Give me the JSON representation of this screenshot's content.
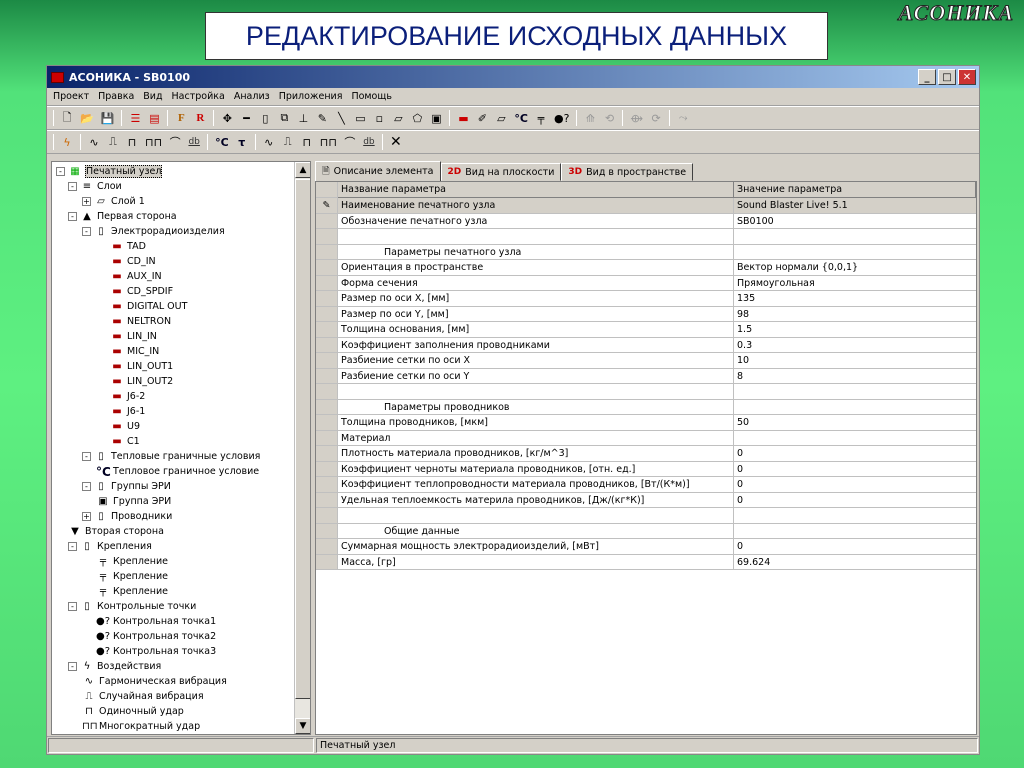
{
  "slide_title": "РЕДАКТИРОВАНИЕ ИСХОДНЫХ ДАННЫХ",
  "logo": "АСОНИКА",
  "window": {
    "title": "АСОНИКА - SB0100"
  },
  "menu": [
    "Проект",
    "Правка",
    "Вид",
    "Настройка",
    "Анализ",
    "Приложения",
    "Помощь"
  ],
  "toolbar1": {
    "f_label": "F",
    "r_label": "R",
    "celsius": "°C"
  },
  "toolbar2": {
    "db": "db",
    "celsius": "°C",
    "tau": "τ"
  },
  "tree": [
    {
      "label": "Печатный узел",
      "level": 0,
      "exp": "-",
      "icon": "board-icon",
      "glyph": "▦",
      "sel": true
    },
    {
      "label": "Слои",
      "level": 1,
      "exp": "-",
      "icon": "layers-icon",
      "glyph": "≡"
    },
    {
      "label": "Слой 1",
      "level": 2,
      "exp": "+",
      "icon": "layer-icon",
      "glyph": "▱"
    },
    {
      "label": "Первая сторона",
      "level": 1,
      "exp": "-",
      "icon": "side-icon",
      "glyph": "▲"
    },
    {
      "label": "Электрорадиоизделия",
      "level": 2,
      "exp": "-",
      "icon": "folder-icon",
      "glyph": "▯"
    },
    {
      "label": "TAD",
      "level": 4,
      "icon": "component-icon",
      "glyph": "▬"
    },
    {
      "label": "CD_IN",
      "level": 4,
      "icon": "component-icon",
      "glyph": "▬"
    },
    {
      "label": "AUX_IN",
      "level": 4,
      "icon": "component-icon",
      "glyph": "▬"
    },
    {
      "label": "CD_SPDIF",
      "level": 4,
      "icon": "component-icon",
      "glyph": "▬"
    },
    {
      "label": "DIGITAL OUT",
      "level": 4,
      "icon": "component-icon",
      "glyph": "▬"
    },
    {
      "label": "NELTRON",
      "level": 4,
      "icon": "component-icon",
      "glyph": "▬"
    },
    {
      "label": "LIN_IN",
      "level": 4,
      "icon": "component-icon",
      "glyph": "▬"
    },
    {
      "label": "MIC_IN",
      "level": 4,
      "icon": "component-icon",
      "glyph": "▬"
    },
    {
      "label": "LIN_OUT1",
      "level": 4,
      "icon": "component-icon",
      "glyph": "▬"
    },
    {
      "label": "LIN_OUT2",
      "level": 4,
      "icon": "component-icon",
      "glyph": "▬"
    },
    {
      "label": "J6-2",
      "level": 4,
      "icon": "component-icon",
      "glyph": "▬"
    },
    {
      "label": "J6-1",
      "level": 4,
      "icon": "component-icon",
      "glyph": "▬"
    },
    {
      "label": "U9",
      "level": 4,
      "icon": "component-icon",
      "glyph": "▬"
    },
    {
      "label": "C1",
      "level": 4,
      "icon": "component-icon",
      "glyph": "▬"
    },
    {
      "label": "Тепловые граничные условия",
      "level": 2,
      "exp": "-",
      "icon": "folder-icon",
      "glyph": "▯"
    },
    {
      "label": "Тепловое граничное условие",
      "level": 3,
      "icon": "celsius-icon",
      "glyph": "°C"
    },
    {
      "label": "Группы ЭРИ",
      "level": 2,
      "exp": "-",
      "icon": "folder-icon",
      "glyph": "▯"
    },
    {
      "label": "Группа ЭРИ",
      "level": 3,
      "icon": "group-icon",
      "glyph": "▣"
    },
    {
      "label": "Проводники",
      "level": 2,
      "exp": "+",
      "icon": "folder-icon",
      "glyph": "▯"
    },
    {
      "label": "Вторая сторона",
      "level": 1,
      "icon": "side2-icon",
      "glyph": "▼"
    },
    {
      "label": "Крепления",
      "level": 1,
      "exp": "-",
      "icon": "folder-icon",
      "glyph": "▯"
    },
    {
      "label": "Крепление",
      "level": 3,
      "icon": "fastener-icon",
      "glyph": "╤"
    },
    {
      "label": "Крепление",
      "level": 3,
      "icon": "fastener-icon",
      "glyph": "╤"
    },
    {
      "label": "Крепление",
      "level": 3,
      "icon": "fastener-icon",
      "glyph": "╤"
    },
    {
      "label": "Контрольные точки",
      "level": 1,
      "exp": "-",
      "icon": "folder-icon",
      "glyph": "▯"
    },
    {
      "label": "Контрольная точка1",
      "level": 3,
      "icon": "checkpoint-icon",
      "glyph": "●?"
    },
    {
      "label": "Контрольная точка2",
      "level": 3,
      "icon": "checkpoint-icon",
      "glyph": "●?"
    },
    {
      "label": "Контрольная точка3",
      "level": 3,
      "icon": "checkpoint-icon",
      "glyph": "●?"
    },
    {
      "label": "Воздействия",
      "level": 1,
      "exp": "-",
      "icon": "lightning-icon",
      "glyph": "ϟ"
    },
    {
      "label": "Гармоническая вибрация",
      "level": 2,
      "icon": "sine-icon",
      "glyph": "∿"
    },
    {
      "label": "Случайная вибрация",
      "level": 2,
      "icon": "random-icon",
      "glyph": "⎍"
    },
    {
      "label": "Одиночный удар",
      "level": 2,
      "icon": "pulse-icon",
      "glyph": "⊓"
    },
    {
      "label": "Многократный удар",
      "level": 2,
      "icon": "pulses-icon",
      "glyph": "⊓⊓"
    }
  ],
  "tabs": [
    {
      "label": "Описание элемента",
      "prefix": "",
      "active": true
    },
    {
      "label": "Вид на плоскости",
      "prefix": "2D"
    },
    {
      "label": "Вид в пространстве",
      "prefix": "3D"
    }
  ],
  "grid": {
    "header": {
      "name": "Название параметра",
      "value": "Значение параметра"
    },
    "rows": [
      {
        "name": "Наименование печатного узла",
        "value": "Sound Blaster Live! 5.1",
        "sel": true
      },
      {
        "name": "Обозначение печатного узла",
        "value": "SB0100"
      },
      {
        "name": "",
        "value": ""
      },
      {
        "name": "Параметры печатного узла",
        "value": "",
        "section": true
      },
      {
        "name": "Ориентация в пространстве",
        "value": "Вектор нормали {0,0,1}"
      },
      {
        "name": "Форма сечения",
        "value": "Прямоугольная"
      },
      {
        "name": "Размер по оси X, [мм]",
        "value": "135"
      },
      {
        "name": "Размер по оси Y, [мм]",
        "value": "98"
      },
      {
        "name": "Толщина основания, [мм]",
        "value": "1.5"
      },
      {
        "name": "Коэффициент заполнения проводниками",
        "value": "0.3"
      },
      {
        "name": "Разбиение сетки по оси X",
        "value": "10"
      },
      {
        "name": "Разбиение сетки по оси Y",
        "value": "8"
      },
      {
        "name": "",
        "value": ""
      },
      {
        "name": "Параметры проводников",
        "value": "",
        "section": true
      },
      {
        "name": "Толщина проводников, [мкм]",
        "value": "50"
      },
      {
        "name": "Материал",
        "value": ""
      },
      {
        "name": "Плотность материала проводников, [кг/м^3]",
        "value": "0"
      },
      {
        "name": "Коэффициент черноты материала проводников, [отн. ед.]",
        "value": "0"
      },
      {
        "name": "Коэффициент теплопроводности материала проводников, [Вт/(К*м)]",
        "value": "0"
      },
      {
        "name": "Удельная теплоемкость материла проводников, [Дж/(кг*К)]",
        "value": "0"
      },
      {
        "name": "",
        "value": ""
      },
      {
        "name": "Общие данные",
        "value": "",
        "section": true
      },
      {
        "name": "Суммарная мощность электрорадиоизделий, [мВт]",
        "value": "0"
      },
      {
        "name": "Масса, [гр]",
        "value": "69.624"
      }
    ]
  },
  "status": {
    "left": "",
    "right": "Печатный узел"
  }
}
